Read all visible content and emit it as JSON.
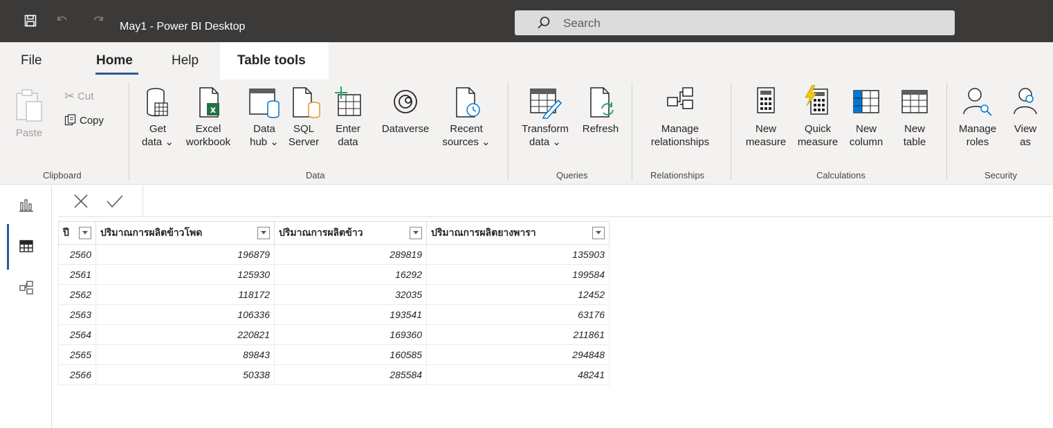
{
  "window": {
    "title": "May1 - Power BI Desktop"
  },
  "search": {
    "label": "Search"
  },
  "tabs": [
    "File",
    "Home",
    "Help",
    "Table tools"
  ],
  "ribbon": {
    "clipboard": {
      "paste": "Paste",
      "cut": "Cut",
      "copy": "Copy",
      "group": "Clipboard"
    },
    "data": {
      "group": "Data",
      "get_data": [
        "Get",
        "data"
      ],
      "excel": [
        "Excel",
        "workbook"
      ],
      "data_hub": [
        "Data",
        "hub"
      ],
      "sql": [
        "SQL",
        "Server"
      ],
      "enter": [
        "Enter",
        "data"
      ],
      "dataverse": [
        "Dataverse"
      ],
      "recent": [
        "Recent",
        "sources"
      ]
    },
    "queries": {
      "group": "Queries",
      "transform": [
        "Transform",
        "data"
      ],
      "refresh": [
        "Refresh"
      ]
    },
    "relationships": {
      "group": "Relationships",
      "manage": [
        "Manage",
        "relationships"
      ]
    },
    "calculations": {
      "group": "Calculations",
      "new_measure": [
        "New",
        "measure"
      ],
      "quick_measure": [
        "Quick",
        "measure"
      ],
      "new_column": [
        "New",
        "column"
      ],
      "new_table": [
        "New",
        "table"
      ]
    },
    "security": {
      "group": "Security",
      "manage_roles": [
        "Manage",
        "roles"
      ],
      "view_as": [
        "View",
        "as"
      ]
    }
  },
  "icons": {
    "save": "save-icon",
    "undo": "undo-icon",
    "redo": "redo-icon",
    "search": "search-icon",
    "report": "report-view-icon",
    "table": "table-view-icon",
    "model": "model-view-icon",
    "cancel": "close-icon",
    "commit": "check-icon"
  },
  "colors": {
    "titlebar": "#3b3a39",
    "accent": "#2b579a",
    "excel_green": "#217346",
    "lightning": "#f2c811"
  },
  "table": {
    "columns": [
      "ปี",
      "ปริมาณการผลิตข้าวโพด",
      "ปริมาณการผลิตข้าว",
      "ปริมาณการผลิตยางพารา"
    ],
    "rows": [
      [
        "2560",
        "196879",
        "289819",
        "135903"
      ],
      [
        "2561",
        "125930",
        "16292",
        "199584"
      ],
      [
        "2562",
        "118172",
        "32035",
        "12452"
      ],
      [
        "2563",
        "106336",
        "193541",
        "63176"
      ],
      [
        "2564",
        "220821",
        "169360",
        "211861"
      ],
      [
        "2565",
        "89843",
        "160585",
        "294848"
      ],
      [
        "2566",
        "50338",
        "285584",
        "48241"
      ]
    ]
  }
}
